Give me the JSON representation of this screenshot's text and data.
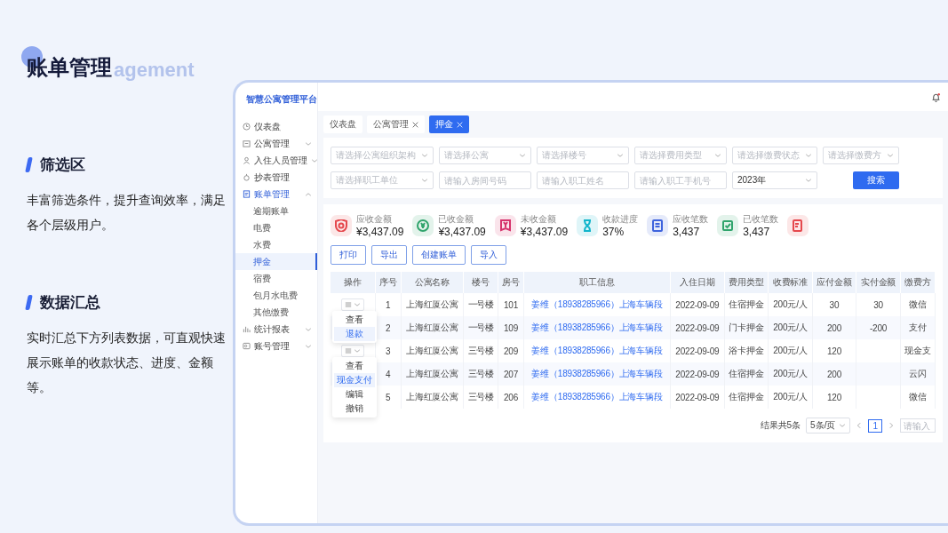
{
  "slide": {
    "title": "账单管理",
    "title_ghost": "agement",
    "sections": [
      {
        "heading": "筛选区",
        "body": "丰富筛选条件，提升查询效率，满足各个层级用户。"
      },
      {
        "heading": "数据汇总",
        "body": "实时汇总下方列表数据，可直观快速展示账单的收款状态、进度、金额等。"
      }
    ]
  },
  "app": {
    "brand": "智慧公寓管理平台",
    "sidebar": [
      {
        "label": "仪表盘",
        "selected": false
      },
      {
        "label": "公寓管理",
        "selected": false,
        "expanded": false
      },
      {
        "label": "入住人员管理",
        "selected": false,
        "expanded": false
      },
      {
        "label": "抄表管理",
        "selected": false
      },
      {
        "label": "账单管理",
        "selected": false,
        "expanded": true,
        "children": [
          {
            "label": "逾期账单",
            "selected": false
          },
          {
            "label": "电费",
            "selected": false
          },
          {
            "label": "水费",
            "selected": false
          },
          {
            "label": "押金",
            "selected": true
          },
          {
            "label": "宿费",
            "selected": false
          },
          {
            "label": "包月水电费",
            "selected": false
          },
          {
            "label": "其他缴费",
            "selected": false
          }
        ]
      },
      {
        "label": "统计报表",
        "selected": false,
        "expanded": false
      },
      {
        "label": "账号管理",
        "selected": false,
        "expanded": false
      }
    ],
    "tabs": [
      {
        "label": "仪表盘",
        "closable": false,
        "selected": false
      },
      {
        "label": "公寓管理",
        "closable": true,
        "selected": false
      },
      {
        "label": "押金",
        "closable": true,
        "selected": true
      }
    ],
    "filters": [
      {
        "kind": "select",
        "placeholder": "请选择公寓组织架构"
      },
      {
        "kind": "select",
        "placeholder": "请选择公寓"
      },
      {
        "kind": "select",
        "placeholder": "请选择楼号"
      },
      {
        "kind": "select",
        "placeholder": "请选择费用类型"
      },
      {
        "kind": "select",
        "placeholder": "请选择缴费状态"
      },
      {
        "kind": "select",
        "placeholder": "请选择缴费方"
      },
      {
        "kind": "select",
        "placeholder": "请选择职工单位"
      },
      {
        "kind": "input",
        "placeholder": "请输入房间号码"
      },
      {
        "kind": "input",
        "placeholder": "请输入职工姓名"
      },
      {
        "kind": "input",
        "placeholder": "请输入职工手机号"
      },
      {
        "kind": "select",
        "value": "2023年"
      },
      {
        "kind": "button",
        "label": "搜索"
      }
    ],
    "stats": [
      {
        "label": "应收金额",
        "value": "¥3,437.09",
        "color": "#e5484d"
      },
      {
        "label": "已收金额",
        "value": "¥3,437.09",
        "color": "#30a46c"
      },
      {
        "label": "未收金额",
        "value": "¥3,437.09",
        "color": "#d6336c"
      },
      {
        "label": "收款进度",
        "value": "37%",
        "color": "#12b5cb"
      },
      {
        "label": "应收笔数",
        "value": "3,437",
        "color": "#3e63dd"
      },
      {
        "label": "已收笔数",
        "value": "3,437",
        "color": "#30a46c"
      },
      {
        "color": "#e5484d"
      }
    ],
    "actions": [
      "打印",
      "导出",
      "创建账单",
      "导入"
    ],
    "table": {
      "columns": [
        {
          "label": "操作",
          "kind": "action"
        },
        {
          "label": "序号",
          "kind": "text"
        },
        {
          "label": "公寓名称",
          "kind": "text"
        },
        {
          "label": "楼号",
          "kind": "text"
        },
        {
          "label": "房号",
          "kind": "text"
        },
        {
          "label": "职工信息",
          "kind": "link"
        },
        {
          "label": "入住日期",
          "kind": "text"
        },
        {
          "label": "费用类型",
          "kind": "text"
        },
        {
          "label": "收费标准",
          "kind": "text"
        },
        {
          "label": "应付金额",
          "kind": "text"
        },
        {
          "label": "实付金额",
          "kind": "text"
        },
        {
          "label": "缴费方",
          "kind": "text"
        }
      ],
      "rows": [
        {
          "cells": [
            "",
            "1",
            "上海红厦公寓",
            "一号楼",
            "101",
            "姜维（18938285966）上海车辆段",
            "2022-09-09",
            "住宿押金",
            "200元/人",
            "30",
            "30",
            "微信"
          ],
          "menu": [
            {
              "label": "查看",
              "selected": false
            },
            {
              "label": "退款",
              "selected": true
            }
          ]
        },
        {
          "cells": [
            "",
            "2",
            "上海红厦公寓",
            "一号楼",
            "109",
            "姜维（18938285966）上海车辆段",
            "2022-09-09",
            "门卡押金",
            "200元/人",
            "200",
            "-200",
            "支付"
          ]
        },
        {
          "cells": [
            "",
            "3",
            "上海红厦公寓",
            "三号楼",
            "209",
            "姜维（18938285966）上海车辆段",
            "2022-09-09",
            "浴卡押金",
            "200元/人",
            "120",
            null,
            "现金支"
          ],
          "menu": [
            {
              "label": "查看",
              "selected": false
            },
            {
              "label": "现金支付",
              "selected": true
            },
            {
              "label": "编辑",
              "selected": false
            },
            {
              "label": "撤销",
              "selected": false
            }
          ]
        },
        {
          "cells": [
            "",
            "4",
            "上海红厦公寓",
            "三号楼",
            "207",
            "姜维（18938285966）上海车辆段",
            "2022-09-09",
            "住宿押金",
            "200元/人",
            "200",
            null,
            "云闪"
          ]
        },
        {
          "cells": [
            "",
            "5",
            "上海红厦公寓",
            "三号楼",
            "206",
            "姜维（18938285966）上海车辆段",
            "2022-09-09",
            "住宿押金",
            "200元/人",
            "120",
            null,
            "微信"
          ]
        }
      ]
    },
    "pagination": {
      "total": "结果共5条",
      "page_size": "5条/页",
      "pages": [
        {
          "label": "1",
          "selected": true
        }
      ],
      "jump_placeholder": "请输入"
    }
  }
}
